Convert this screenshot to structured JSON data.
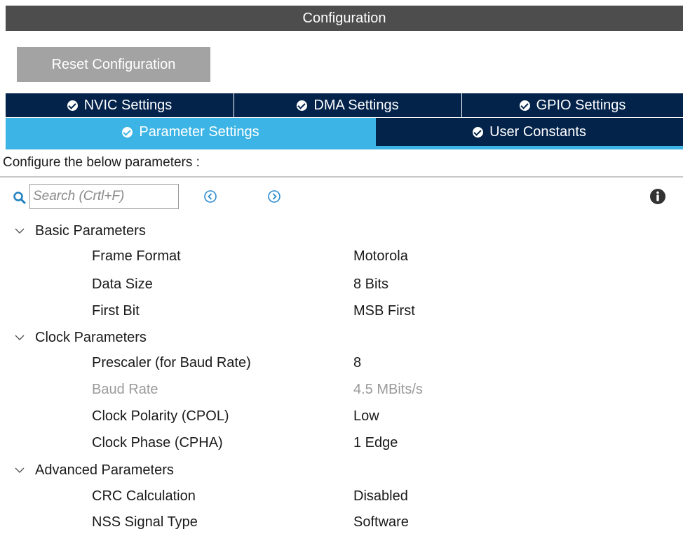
{
  "header": {
    "title": "Configuration"
  },
  "toolbar": {
    "reset_label": "Reset Configuration"
  },
  "tabs": {
    "row1": [
      {
        "label": "NVIC Settings"
      },
      {
        "label": "DMA Settings"
      },
      {
        "label": "GPIO Settings"
      }
    ],
    "row2": [
      {
        "label": "Parameter Settings",
        "active": true
      },
      {
        "label": "User Constants"
      }
    ]
  },
  "instructions": "Configure the below parameters :",
  "search": {
    "placeholder": "Search (Crtl+F)",
    "value": ""
  },
  "groups": [
    {
      "title": "Basic Parameters",
      "params": [
        {
          "name": "Frame Format",
          "value": "Motorola"
        },
        {
          "name": "Data Size",
          "value": "8 Bits"
        },
        {
          "name": "First Bit",
          "value": "MSB First"
        }
      ]
    },
    {
      "title": "Clock Parameters",
      "params": [
        {
          "name": "Prescaler (for Baud Rate)",
          "value": "8"
        },
        {
          "name": "Baud Rate",
          "value": "4.5 MBits/s",
          "disabled": true
        },
        {
          "name": "Clock Polarity (CPOL)",
          "value": "Low"
        },
        {
          "name": "Clock Phase (CPHA)",
          "value": "1 Edge"
        }
      ]
    },
    {
      "title": "Advanced Parameters",
      "params": [
        {
          "name": "CRC Calculation",
          "value": "Disabled"
        },
        {
          "name": "NSS Signal Type",
          "value": "Software"
        }
      ]
    }
  ],
  "colors": {
    "titlebar": "#4d4d4d",
    "tab_dark": "#03234b",
    "tab_active": "#3cb4e6",
    "button_gray": "#a3a3a3",
    "disabled_text": "#9a9a9a"
  },
  "icons": [
    "search-icon",
    "previous-icon",
    "next-icon",
    "info-icon",
    "check-circle-icon",
    "chevron-down-icon"
  ]
}
